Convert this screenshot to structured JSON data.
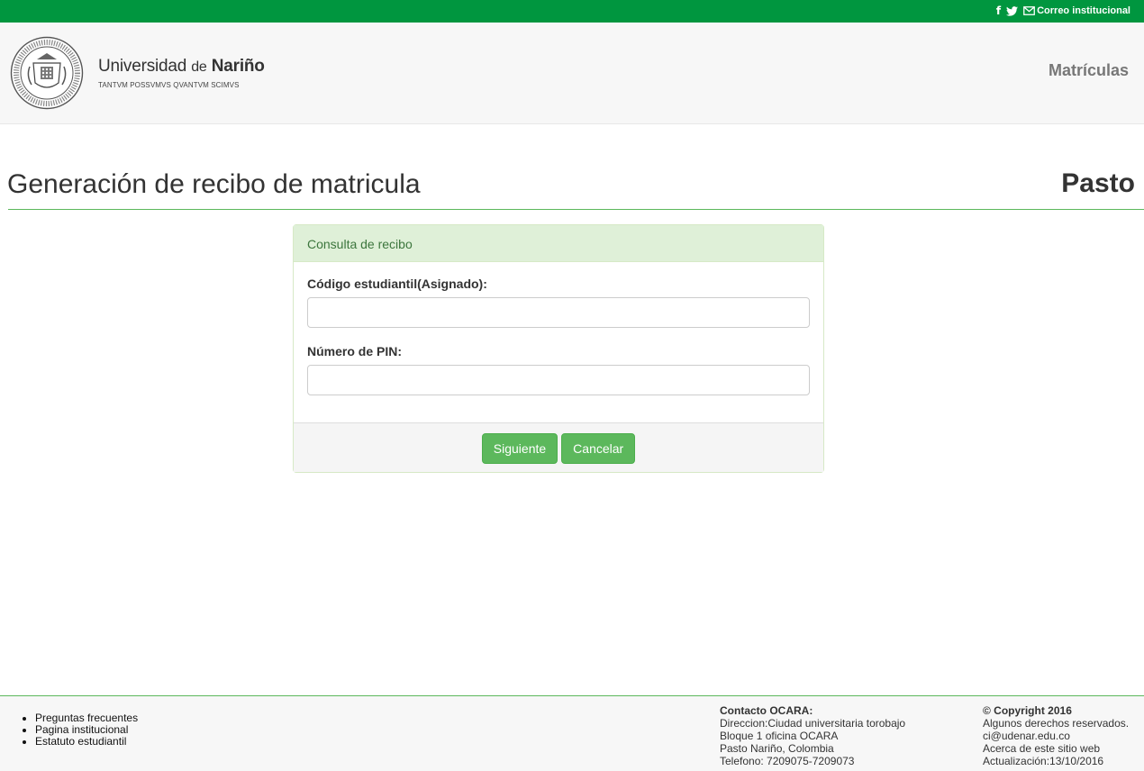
{
  "topbar": {
    "facebook_icon": "facebook-icon",
    "twitter_icon": "twitter-icon",
    "mail_icon": "envelope-icon",
    "mail_label": "Correo institucional"
  },
  "header": {
    "brand_name_1": "Universidad",
    "brand_name_2": "de",
    "brand_name_3": "Nariño",
    "motto": "TANTVM POSSVMVS QVANTVM SCIMVS",
    "nav_label": "Matrículas"
  },
  "page": {
    "title": "Generación de recibo de matricula",
    "campus": "Pasto"
  },
  "form": {
    "heading": "Consulta de recibo",
    "code_label": "Código estudiantil(Asignado):",
    "code_value": "",
    "pin_label": "Número de PIN:",
    "pin_value": "",
    "next_label": "Siguiente",
    "cancel_label": "Cancelar"
  },
  "footer": {
    "links": [
      "Preguntas frecuentes",
      "Pagina institucional",
      "Estatuto estudiantil"
    ],
    "contact_title": "Contacto OCARA:",
    "contact_lines": [
      "Direccion:Ciudad universitaria torobajo",
      "Bloque 1 oficina OCARA",
      "Pasto Nariño, Colombia",
      "Telefono: 7209075-7209073"
    ],
    "copyright_title": "© Copyright 2016",
    "copyright_lines": [
      "Algunos derechos reservados.",
      "ci@udenar.edu.co",
      "Acerca de este sitio web",
      "Actualización:13/10/2016"
    ]
  },
  "colors": {
    "topbar": "#00963f",
    "accent": "#5cb85c",
    "panel_heading_bg": "#dff0d8",
    "panel_heading_text": "#3c763d"
  }
}
